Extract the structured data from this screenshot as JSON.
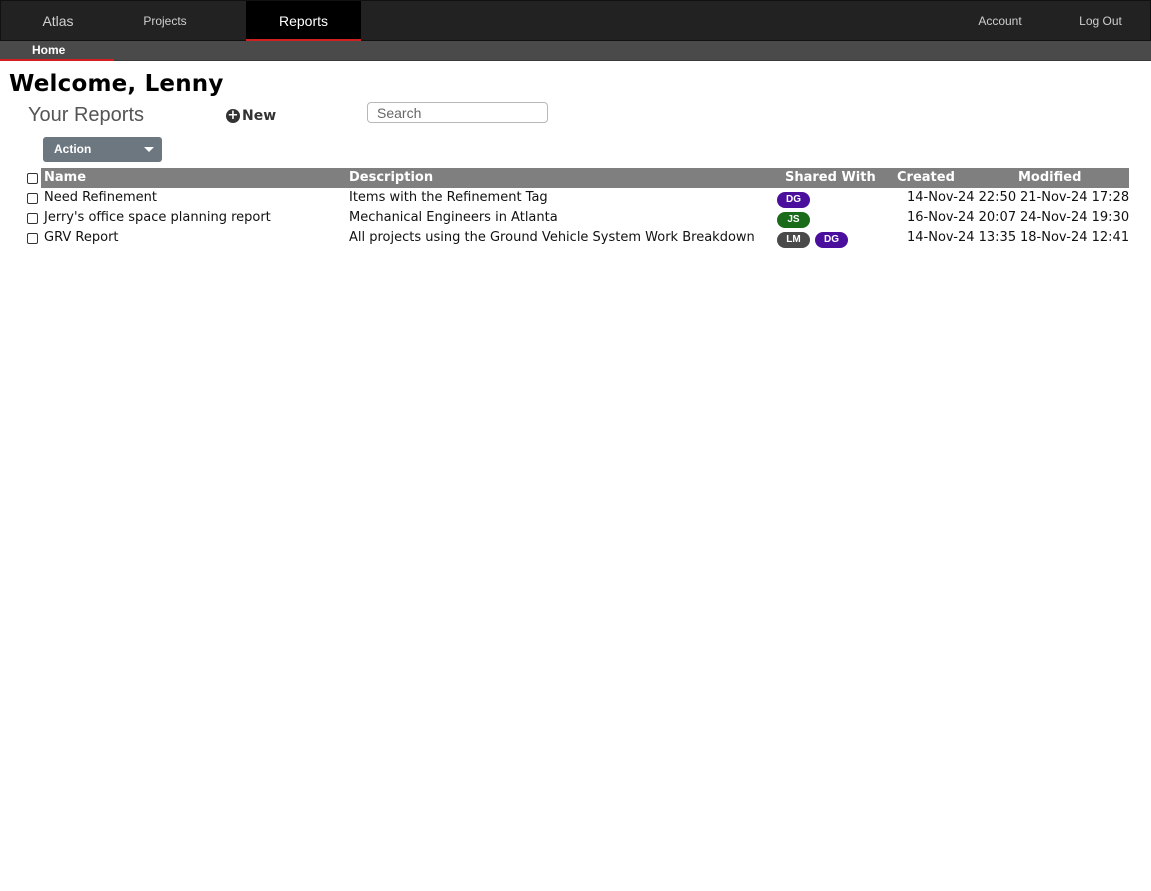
{
  "topnav": {
    "brand": "Atlas",
    "projects": "Projects",
    "reports": "Reports",
    "account": "Account",
    "logout": "Log Out"
  },
  "subnav": {
    "home": "Home"
  },
  "main": {
    "welcome": "Welcome, Lenny",
    "section_title": "Your Reports",
    "new_label": "New",
    "search_placeholder": "Search",
    "action_label": "Action"
  },
  "table": {
    "columns": [
      "Name",
      "Description",
      "Shared With",
      "Created",
      "Modified"
    ],
    "rows": [
      {
        "name": "Need Refinement",
        "description": "Items with the Refinement Tag",
        "shared": [
          {
            "initials": "DG",
            "color": "#4b0f9e"
          }
        ],
        "created": "14-Nov-24 22:50",
        "modified": "21-Nov-24 17:28"
      },
      {
        "name": "Jerry's office space planning report",
        "description": "Mechanical Engineers in Atlanta",
        "shared": [
          {
            "initials": "JS",
            "color": "#1a6b1a"
          }
        ],
        "created": "16-Nov-24 20:07",
        "modified": "24-Nov-24 19:30"
      },
      {
        "name": "GRV Report",
        "description": "All projects using the Ground Vehicle System Work Breakdown",
        "shared": [
          {
            "initials": "LM",
            "color": "#4a4a4a"
          },
          {
            "initials": "DG",
            "color": "#4b0f9e"
          }
        ],
        "created": "14-Nov-24 13:35",
        "modified": "18-Nov-24 12:41"
      }
    ]
  },
  "colors": {
    "topbar": "#222222",
    "active_tab": "#000000",
    "accent_red": "#d21f1f",
    "table_header": "#7f7f7f",
    "action_button": "#6d7780"
  }
}
